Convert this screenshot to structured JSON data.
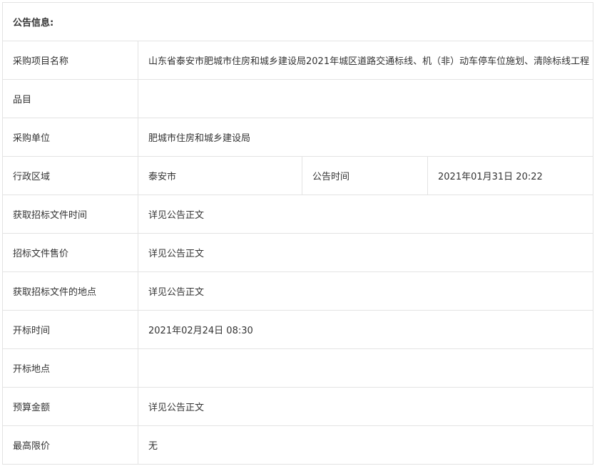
{
  "header": {
    "title": "公告信息:"
  },
  "rows": {
    "project_name": {
      "label": "采购项目名称",
      "value": "山东省泰安市肥城市住房和城乡建设局2021年城区道路交通标线、机（非）动车停车位施划、清除标线工程"
    },
    "items": {
      "label": "品目",
      "value": ""
    },
    "purchaser": {
      "label": "采购单位",
      "value": "肥城市住房和城乡建设局"
    },
    "region": {
      "label": "行政区域",
      "value": "泰安市",
      "label2": "公告时间",
      "value2": "2021年01月31日 20:22"
    },
    "doc_time": {
      "label": "获取招标文件时间",
      "value": "详见公告正文"
    },
    "doc_price": {
      "label": "招标文件售价",
      "value": "详见公告正文"
    },
    "doc_place": {
      "label": "获取招标文件的地点",
      "value": "详见公告正文"
    },
    "open_time": {
      "label": "开标时间",
      "value": "2021年02月24日 08:30"
    },
    "open_place": {
      "label": "开标地点",
      "value": ""
    },
    "budget": {
      "label": "预算金额",
      "value": "详见公告正文"
    },
    "max_price": {
      "label": "最高限价",
      "value": "无"
    }
  }
}
